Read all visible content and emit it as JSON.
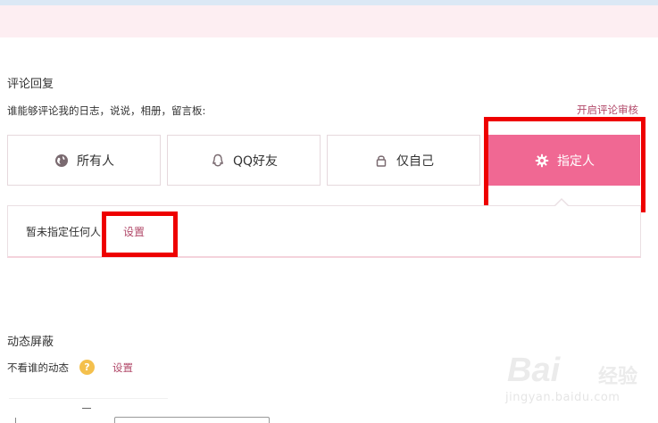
{
  "comment_reply": {
    "title": "评论回复",
    "question": "谁能够评论我的日志，说说，相册，留言板:",
    "moderation_link": "开启评论审核",
    "options": [
      {
        "label": "所有人",
        "icon": "globe-icon"
      },
      {
        "label": "QQ好友",
        "icon": "qq-penguin-icon"
      },
      {
        "label": "仅自己",
        "icon": "lock-icon"
      },
      {
        "label": "指定人",
        "icon": "gear-icon",
        "selected": true
      }
    ],
    "panel": {
      "status_text": "暂未指定任何人",
      "settings_link": "设置"
    }
  },
  "feed_block": {
    "title": "动态屏蔽",
    "label": "不看谁的动态",
    "help_glyph": "?",
    "settings_link": "设置"
  },
  "watermark": {
    "brand": "Bai",
    "brand_cn": "经验",
    "url": "jingyan.baidu.com"
  },
  "colors": {
    "accent": "#f06893",
    "link": "#b24a6a",
    "annotation_red": "#ee0000",
    "help_badge": "#f4c04d"
  }
}
